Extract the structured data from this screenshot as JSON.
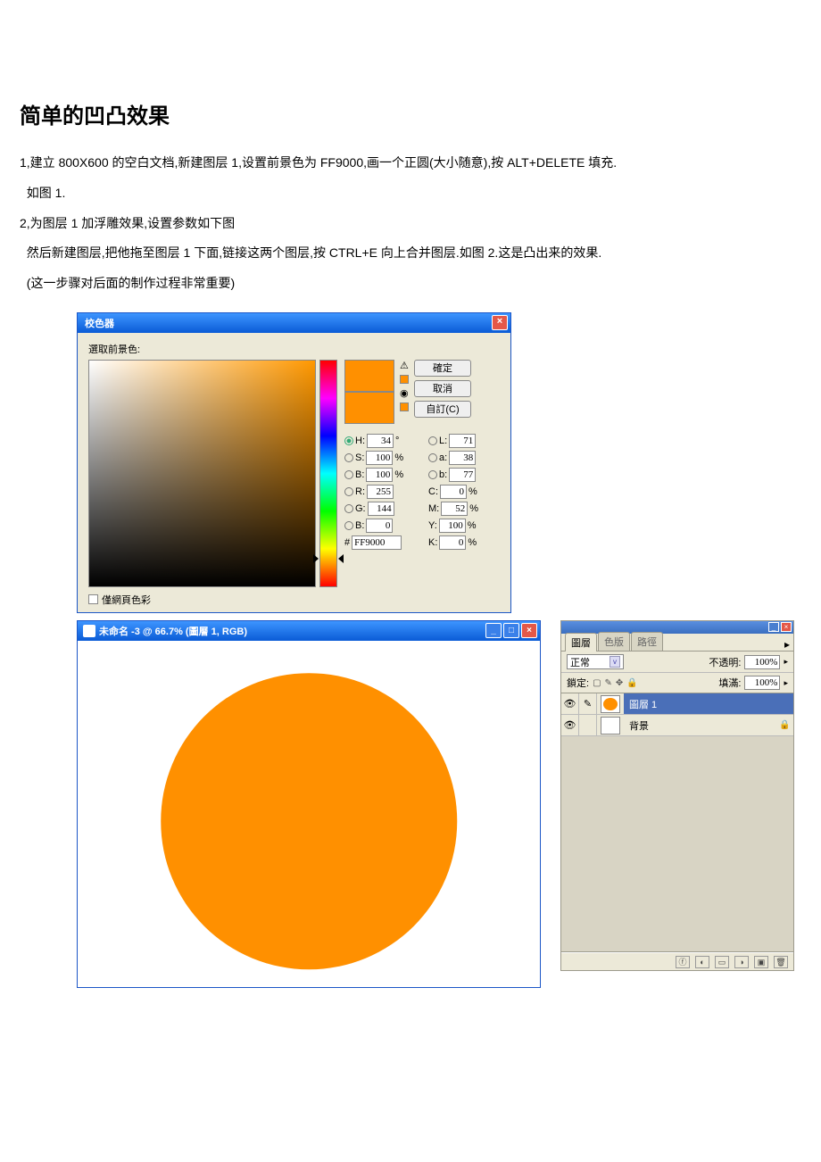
{
  "doc": {
    "title": "简单的凹凸效果",
    "p1a": "1,建立 800X600 的空白文档,新建图层 1,设置前景色为 FF9000,画一个正圆(大小随意),按 ALT+DELETE 填充.",
    "p1b": "  如图 1.",
    "p2a": "2,为图层 1 加浮雕效果,设置参数如下图",
    "p2b": "  然后新建图层,把他拖至图层 1 下面,链接这两个图层,按 CTRL+E 向上合并图层.如图 2.这是凸出来的效果.",
    "p2c": "  (这一步骤对后面的制作过程非常重要)"
  },
  "picker": {
    "title": "校色器",
    "label": "選取前景色:",
    "btn_ok": "確定",
    "btn_cancel": "取消",
    "btn_custom": "自訂(C)",
    "H": "34",
    "H_unit": "°",
    "L": "71",
    "S": "100",
    "a": "38",
    "V": "100",
    "b": "77",
    "R": "255",
    "C": "0",
    "G": "144",
    "M": "52",
    "B": "0",
    "Y": "100",
    "hex": "FF9000",
    "K": "0",
    "webonly": "僅網頁色彩"
  },
  "canvas": {
    "title": "未命名 -3 @ 66.7% (圖層 1, RGB)"
  },
  "layers": {
    "tab_layers": "圖層",
    "tab_channels": "色版",
    "tab_paths": "路徑",
    "blend": "正常",
    "opacity_label": "不透明:",
    "opacity": "100%",
    "lock_label": "鎖定:",
    "fill_label": "填滿:",
    "fill": "100%",
    "layer1": "圖層 1",
    "bg": "背景"
  }
}
